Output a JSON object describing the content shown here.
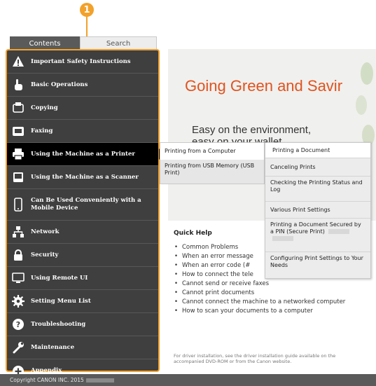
{
  "callout": {
    "number": "1"
  },
  "tabs": {
    "contents": "Contents",
    "search": "Search"
  },
  "sidebar": {
    "items": [
      {
        "label": "Important Safety Instructions",
        "icon": "warning-icon"
      },
      {
        "label": "Basic Operations",
        "icon": "hand-pointer-icon"
      },
      {
        "label": "Copying",
        "icon": "copy-icon"
      },
      {
        "label": "Faxing",
        "icon": "fax-icon"
      },
      {
        "label": "Using the Machine as a Printer",
        "icon": "printer-icon"
      },
      {
        "label": "Using the Machine as a Scanner",
        "icon": "scanner-icon"
      },
      {
        "label": "Can Be Used Conveniently with a Mobile Device",
        "icon": "mobile-device-icon"
      },
      {
        "label": "Network",
        "icon": "network-icon"
      },
      {
        "label": "Security",
        "icon": "lock-icon"
      },
      {
        "label": "Using Remote UI",
        "icon": "monitor-icon"
      },
      {
        "label": "Setting Menu List",
        "icon": "gear-icon"
      },
      {
        "label": "Troubleshooting",
        "icon": "question-icon"
      },
      {
        "label": "Maintenance",
        "icon": "wrench-icon"
      },
      {
        "label": "Appendix",
        "icon": "plus-icon"
      }
    ]
  },
  "hero": {
    "title": "Going Green and Savir",
    "subtitle_line1": "Easy on the environment,",
    "subtitle_line2": "easy on your wallet"
  },
  "flyout1": {
    "items": [
      "Printing from a Computer",
      "Printing from USB Memory (USB Print)"
    ]
  },
  "flyout2": {
    "items": [
      "Printing a Document",
      "Canceling Prints",
      "Checking the Printing Status and Log",
      "Various Print Settings",
      "Printing a Document Secured by a PIN (Secure Print)",
      "Configuring Print Settings to Your Needs"
    ]
  },
  "quick_help": {
    "title": "Quick Help",
    "items": [
      "Common Problems",
      "When an error message",
      "When an error code (#",
      "How to connect the tele",
      "Cannot send or receive faxes",
      "Cannot print documents",
      "Cannot connect the machine to a networked computer",
      "How to scan your documents to a computer"
    ],
    "note": "For driver installation, see the driver installation guide available on the accompanied DVD-ROM or from the Canon website."
  },
  "footer": {
    "copyright": "Copyright CANON INC. 2015"
  },
  "colors": {
    "accent": "#f2a12a",
    "hero_title": "#e0531e",
    "sidebar_bg": "#3f3f3f"
  }
}
